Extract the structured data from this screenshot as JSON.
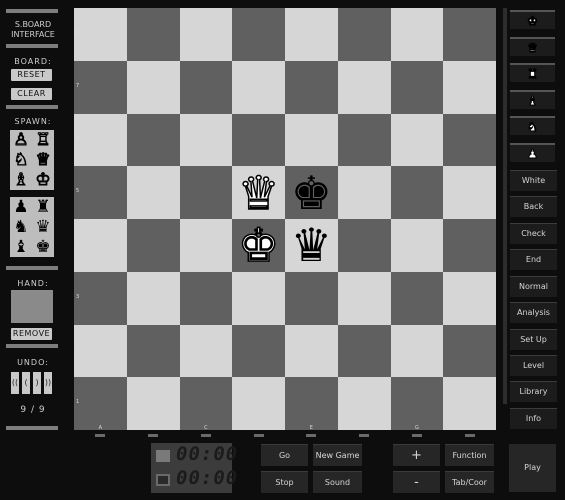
{
  "left_panel": {
    "title": "S.BOARD INTERFACE",
    "board_label": "BOARD:",
    "reset_label": "RESET",
    "clear_label": "CLEAR",
    "spawn_label": "SPAWN:",
    "spawn_white": [
      "♙",
      "♖",
      "♘",
      "♕",
      "♗",
      "♔"
    ],
    "spawn_black": [
      "♟",
      "♜",
      "♞",
      "♛",
      "♝",
      "♚"
    ],
    "hand_label": "HAND:",
    "remove_label": "REMOVE",
    "undo_label": "UNDO:",
    "undo_buttons": [
      "((",
      "(",
      ")",
      "))"
    ],
    "undo_count": "9 / 9"
  },
  "board": {
    "ranks": [
      "8",
      "7",
      "6",
      "5",
      "4",
      "3",
      "2",
      "1"
    ],
    "files": [
      "A",
      "B",
      "C",
      "D",
      "E",
      "F",
      "G",
      "H"
    ],
    "pieces": {
      "D5": {
        "glyph": "♛",
        "color": "white"
      },
      "E5": {
        "glyph": "♚",
        "color": "black"
      },
      "D4": {
        "glyph": "♚",
        "color": "white"
      },
      "E4": {
        "glyph": "♛",
        "color": "black"
      }
    }
  },
  "right_panel": {
    "promotion": [
      "♚",
      "♛",
      "♜",
      "♝",
      "♞",
      "♟"
    ],
    "controls": [
      "White",
      "Back",
      "Check",
      "End"
    ],
    "modes": [
      "Normal",
      "Analysis",
      "Set Up",
      "Level",
      "Library",
      "Info"
    ],
    "turn_color": "#d21a1a",
    "mode_color": "#27c527"
  },
  "bottom": {
    "clock_top": "00:00",
    "clock_bottom": "00:00",
    "go_label": "Go",
    "new_game_label": "New Game",
    "plus_label": "+",
    "function_label": "Function",
    "stop_label": "Stop",
    "sound_label": "Sound",
    "minus_label": "-",
    "tab_coor_label": "Tab/Coor",
    "play_label": "Play"
  }
}
